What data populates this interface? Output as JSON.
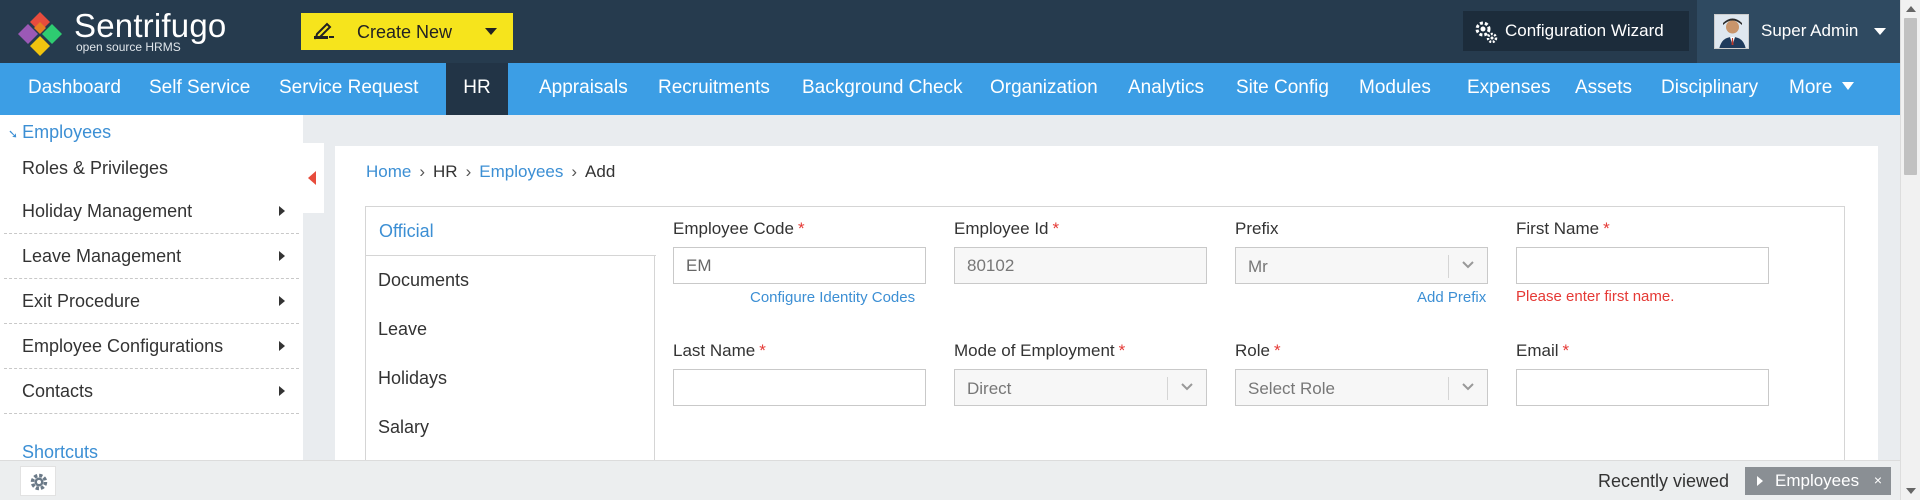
{
  "app": {
    "brand_name": "Sentrifugo",
    "brand_tagline": "open source HRMS",
    "create_new_label": "Create New",
    "config_wizard_label": "Configuration Wizard",
    "user_name": "Super Admin"
  },
  "nav": {
    "items": [
      "Dashboard",
      "Self Service",
      "Service Request",
      "HR",
      "Appraisals",
      "Recruitments",
      "Background Check",
      "Organization",
      "Analytics",
      "Site Config",
      "Modules",
      "Expenses",
      "Assets",
      "Disciplinary"
    ],
    "active": "HR",
    "more_label": "More"
  },
  "sidebar": {
    "header": "Employees",
    "items": [
      {
        "label": "Roles & Privileges",
        "has_submenu": false
      },
      {
        "label": "Holiday Management",
        "has_submenu": true
      },
      {
        "label": "Leave Management",
        "has_submenu": true
      },
      {
        "label": "Exit Procedure",
        "has_submenu": true
      },
      {
        "label": "Employee Configurations",
        "has_submenu": true
      },
      {
        "label": "Contacts",
        "has_submenu": true
      }
    ],
    "shortcuts_label": "Shortcuts"
  },
  "breadcrumb": {
    "home": "Home",
    "hr": "HR",
    "employees": "Employees",
    "current": "Add",
    "separator": "›"
  },
  "tabs": {
    "items": [
      "Official",
      "Documents",
      "Leave",
      "Holidays",
      "Salary"
    ],
    "active": "Official"
  },
  "form": {
    "employee_code": {
      "label": "Employee Code",
      "required_mark": "*",
      "value": "EM",
      "helper": "Configure Identity Codes"
    },
    "employee_id": {
      "label": "Employee Id",
      "required_mark": "*",
      "value": "80102"
    },
    "prefix": {
      "label": "Prefix",
      "selected": "Mr",
      "helper": "Add Prefix"
    },
    "first_name": {
      "label": "First Name",
      "required_mark": "*",
      "value": "",
      "error": "Please enter first name."
    },
    "last_name": {
      "label": "Last Name",
      "required_mark": "*",
      "value": ""
    },
    "mode_of_employment": {
      "label": "Mode of Employment",
      "required_mark": "*",
      "selected": "Direct"
    },
    "role": {
      "label": "Role",
      "required_mark": "*",
      "selected": "Select Role"
    },
    "email": {
      "label": "Email",
      "required_mark": "*",
      "value": ""
    }
  },
  "footer": {
    "recently_viewed_label": "Recently viewed",
    "recent_items": [
      "Employees"
    ],
    "close_glyph": "×"
  },
  "colors": {
    "topbar": "#263b4e",
    "navbar": "#3c9ee5",
    "nav_active": "#223446",
    "create_button": "#f6e41c",
    "link": "#3c8fd4",
    "error": "#e53935"
  },
  "icons": [
    "sentrifugo-logo-icon",
    "create-new-pencil-icon",
    "gear-icon",
    "chevron-down-icon",
    "caret-right-icon",
    "collapse-left-icon",
    "scroll-up-icon",
    "scroll-down-icon"
  ]
}
